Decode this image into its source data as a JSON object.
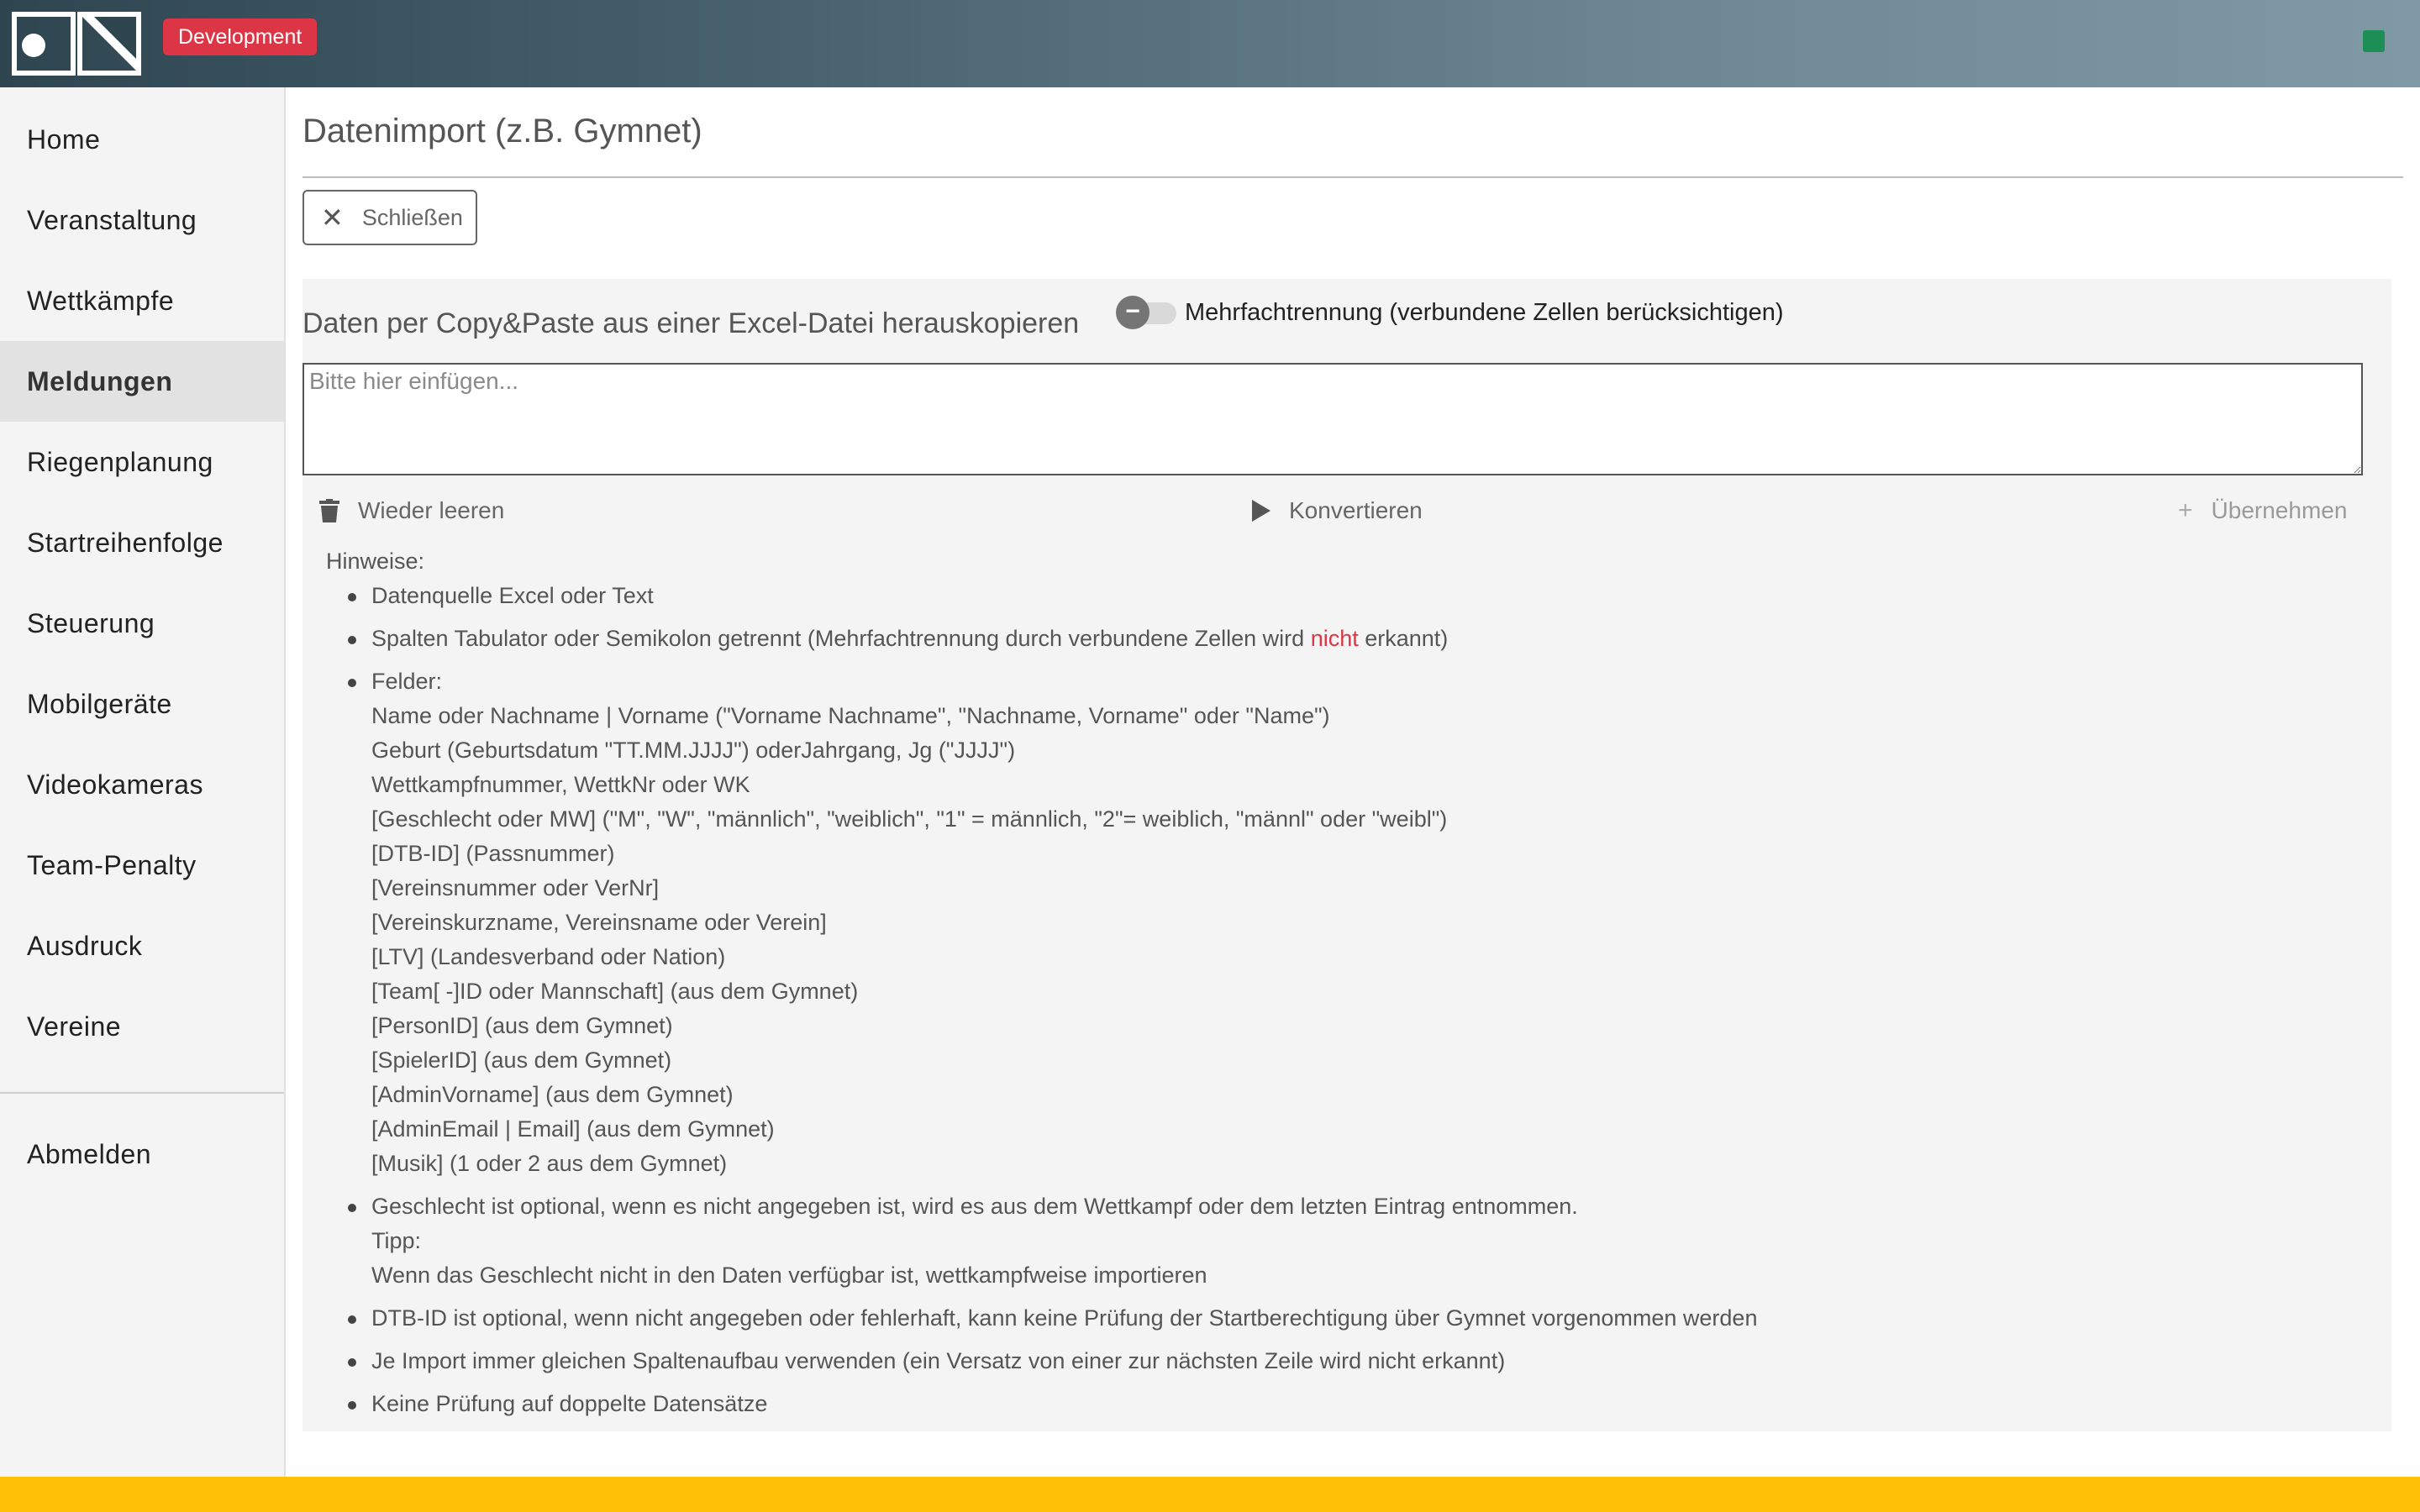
{
  "header": {
    "env_badge": "Development",
    "status_color": "#1e8e57",
    "logo_icon": "app-logo-icon"
  },
  "sidebar": {
    "items": [
      {
        "label": "Home"
      },
      {
        "label": "Veranstaltung"
      },
      {
        "label": "Wettkämpfe"
      },
      {
        "label": "Meldungen",
        "active": true
      },
      {
        "label": "Riegenplanung"
      },
      {
        "label": "Startreihenfolge"
      },
      {
        "label": "Steuerung"
      },
      {
        "label": "Mobilgeräte"
      },
      {
        "label": "Videokameras"
      },
      {
        "label": "Team-Penalty"
      },
      {
        "label": "Ausdruck"
      },
      {
        "label": "Vereine"
      }
    ],
    "logout": "Abmelden"
  },
  "main": {
    "title": "Datenimport (z.B. Gymnet)",
    "close_label": "Schließen",
    "panel": {
      "heading": "Daten per Copy&Paste aus einer Excel-Datei herauskopieren",
      "toggle_label": "Mehrfachtrennung (verbundene Zellen berücksichtigen)",
      "toggle_on": false,
      "paste_placeholder": "Bitte hier einfügen...",
      "paste_value": "",
      "actions": {
        "clear": "Wieder leeren",
        "convert": "Konvertieren",
        "apply": "Übernehmen"
      }
    },
    "hints": {
      "title": "Hinweise:",
      "h1": "Datenquelle Excel oder Text",
      "h2_pre": "Spalten Tabulator oder Semikolon getrennt (Mehrfachtrennung durch verbundene Zellen wird ",
      "h2_warn": "nicht",
      "h2_post": " erkannt)",
      "fields_title": "Felder:",
      "fields": [
        "Name oder Nachname | Vorname (\"Vorname Nachname\", \"Nachname, Vorname\" oder \"Name\")",
        "Geburt (Geburtsdatum \"TT.MM.JJJJ\") oderJahrgang, Jg (\"JJJJ\")",
        "Wettkampfnummer, WettkNr oder WK",
        "[Geschlecht oder MW] (\"M\", \"W\", \"männlich\", \"weiblich\", \"1\" = männlich, \"2\"= weiblich, \"männl\" oder \"weibl\")",
        "[DTB-ID] (Passnummer)",
        "[Vereinsnummer oder VerNr]",
        "[Vereinskurzname, Vereinsname oder Verein]",
        "[LTV] (Landesverband oder Nation)",
        "[Team[ -]ID oder Mannschaft] (aus dem Gymnet)",
        "[PersonID] (aus dem Gymnet)",
        "[SpielerID] (aus dem Gymnet)",
        "[AdminVorname] (aus dem Gymnet)",
        "[AdminEmail | Email] (aus dem Gymnet)",
        "[Musik] (1 oder 2 aus dem Gymnet)"
      ],
      "gender_note": "Geschlecht ist optional, wenn es nicht angegeben ist, wird es aus dem Wettkampf oder dem letzten Eintrag entnommen.",
      "tip_title": "Tipp:",
      "tip_text": "Wenn das Geschlecht nicht in den Daten verfügbar ist, wettkampfweise importieren",
      "h5": "DTB-ID ist optional, wenn nicht angegeben oder fehlerhaft, kann keine Prüfung der Startberechtigung über Gymnet vorgenommen werden",
      "h6": "Je Import immer gleichen Spaltenaufbau verwenden (ein Versatz von einer zur nächsten Zeile wird nicht erkannt)",
      "h7": "Keine Prüfung auf doppelte Datensätze"
    }
  },
  "colors": {
    "accent_red": "#dc3545",
    "footer_yellow": "#ffc107"
  }
}
